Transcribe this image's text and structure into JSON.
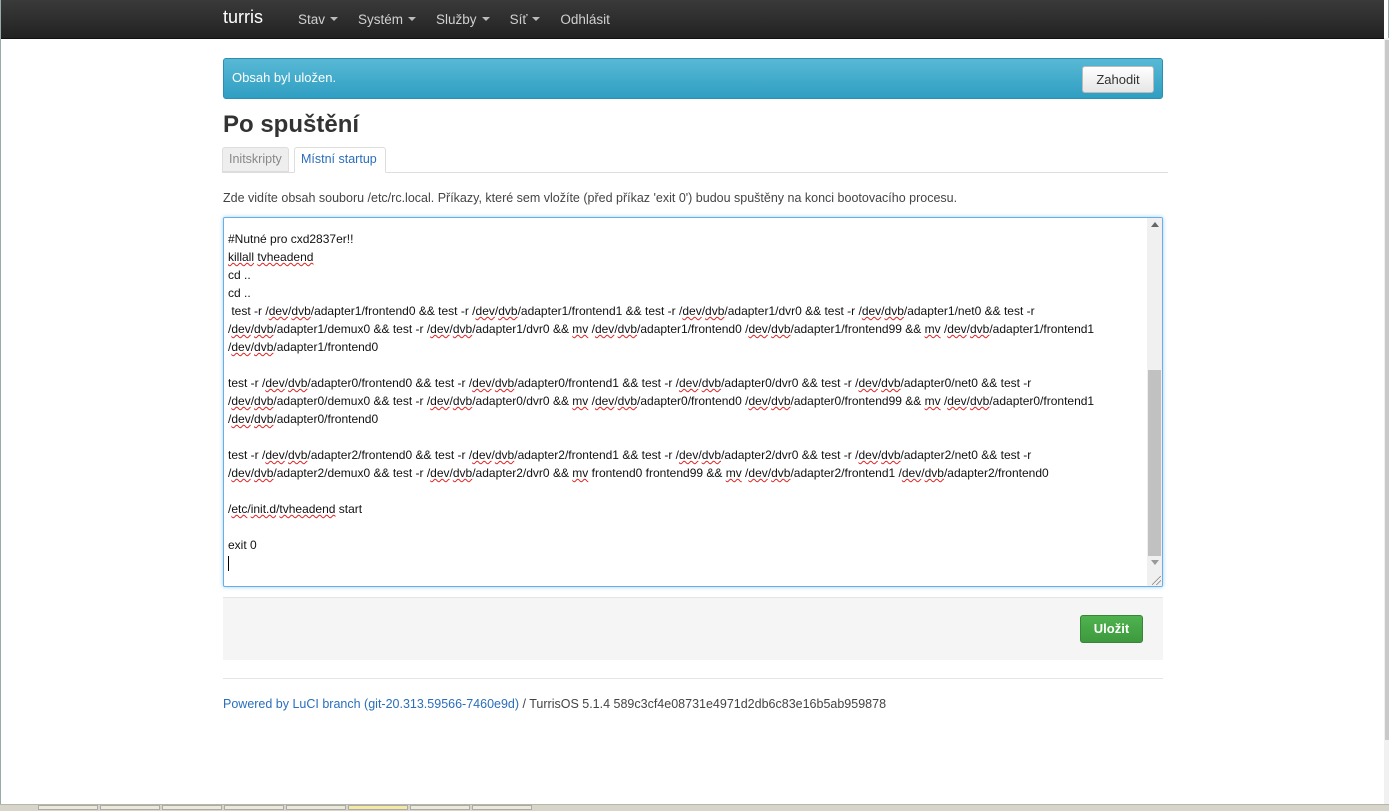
{
  "navbar": {
    "brand": "turris",
    "items": [
      {
        "label": "Stav",
        "dropdown": true
      },
      {
        "label": "Systém",
        "dropdown": true
      },
      {
        "label": "Služby",
        "dropdown": true
      },
      {
        "label": "Síť",
        "dropdown": true
      },
      {
        "label": "Odhlásit",
        "dropdown": false
      }
    ]
  },
  "alert": {
    "message": "Obsah byl uložen.",
    "dismiss_label": "Zahodit"
  },
  "page": {
    "title": "Po spuštění",
    "tabs": [
      {
        "label": "Initskripty",
        "active": false
      },
      {
        "label": "Místní startup",
        "active": true
      }
    ],
    "description": "Zde vidíte obsah souboru /etc/rc.local. Příkazy, které sem vložíte (před příkaz 'exit 0') budou spuštěny na konci bootovacího procesu."
  },
  "editor": {
    "lines": [
      "#Nutné pro cxd2837er!!",
      "killall tvheadend",
      "cd ..",
      "cd ..",
      " test -r /dev/dvb/adapter1/frontend0 && test -r /dev/dvb/adapter1/frontend1 && test -r /dev/dvb/adapter1/dvr0 && test -r /dev/dvb/adapter1/net0 && test -r /dev/dvb/adapter1/demux0 && test -r /dev/dvb/adapter1/dvr0 && mv /dev/dvb/adapter1/frontend0 /dev/dvb/adapter1/frontend99 && mv /dev/dvb/adapter1/frontend1 /dev/dvb/adapter1/frontend0",
      "",
      "test -r /dev/dvb/adapter0/frontend0 && test -r /dev/dvb/adapter0/frontend1 && test -r /dev/dvb/adapter0/dvr0 && test -r /dev/dvb/adapter0/net0 && test -r /dev/dvb/adapter0/demux0 && test -r /dev/dvb/adapter0/dvr0 && mv /dev/dvb/adapter0/frontend0 /dev/dvb/adapter0/frontend99 && mv /dev/dvb/adapter0/frontend1 /dev/dvb/adapter0/frontend0",
      "",
      "test -r /dev/dvb/adapter2/frontend0 && test -r /dev/dvb/adapter2/frontend1 && test -r /dev/dvb/adapter2/dvr0 && test -r /dev/dvb/adapter2/net0 && test -r /dev/dvb/adapter2/demux0 && test -r /dev/dvb/adapter2/dvr0 && mv frontend0 frontend99 && mv /dev/dvb/adapter2/frontend1 /dev/dvb/adapter2/frontend0",
      "",
      "/etc/init.d/tvheadend start",
      "",
      "exit 0"
    ]
  },
  "actions": {
    "save_label": "Uložit"
  },
  "footer": {
    "link_text": "Powered by LuCI branch (git-20.313.59566-7460e9d)",
    "rest_text": " / TurrisOS 5.1.4 589c3cf4e08731e4971d2db6c83e16b5ab959878"
  },
  "colors": {
    "navbar": "#222222",
    "alert": "#3aa7cc",
    "save_button": "#449d44",
    "link": "#2a6ebb"
  }
}
